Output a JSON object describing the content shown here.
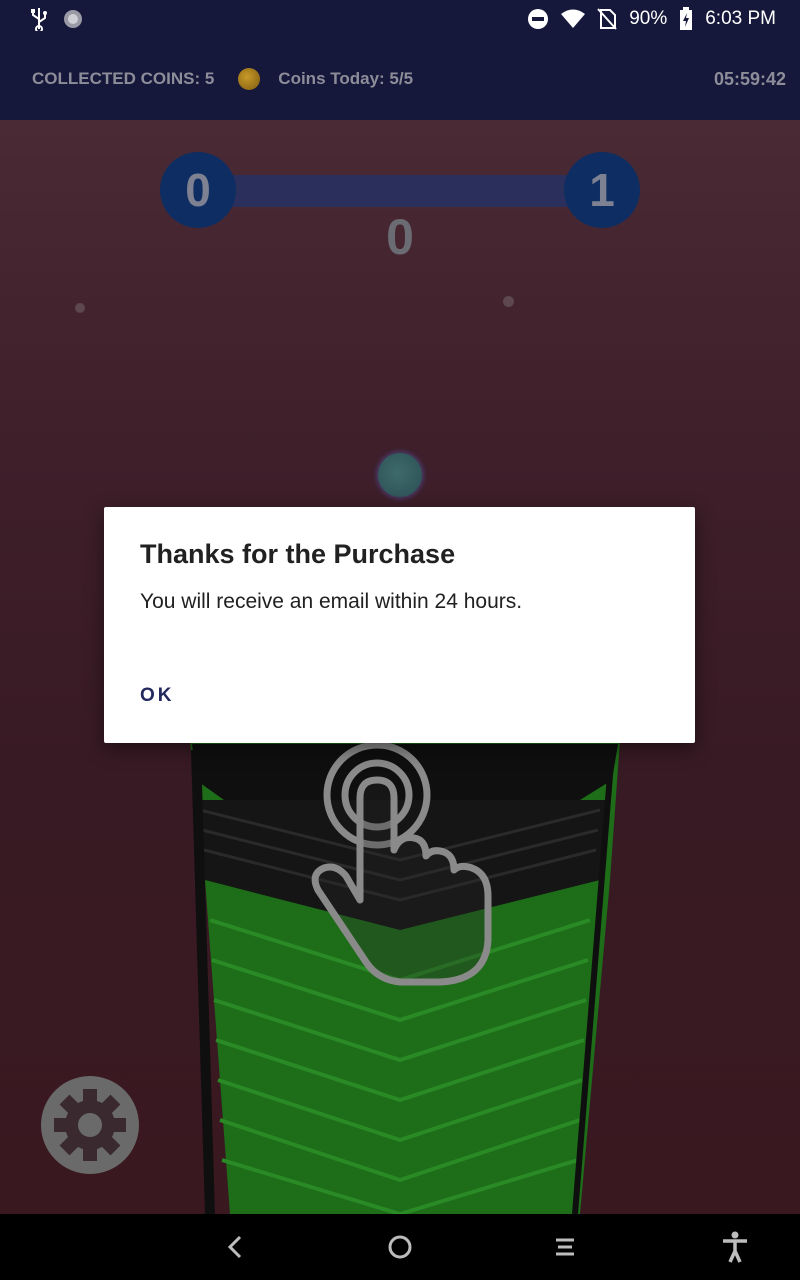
{
  "status_bar": {
    "battery": "90%",
    "time": "6:03 PM",
    "icons": [
      "usb-icon",
      "sync-icon",
      "do-not-disturb-icon",
      "wifi-icon",
      "no-sim-icon",
      "battery-charging-icon"
    ]
  },
  "header": {
    "collected_coins": "COLLECTED COINS: 5",
    "coins_today": "Coins Today:  5/5",
    "timer": "05:59:42"
  },
  "game": {
    "level_current": "0",
    "level_next": "1",
    "score": "0",
    "level_progress": 0
  },
  "dialog": {
    "title": "Thanks for the Purchase",
    "message": "You will receive an email within 24 hours.",
    "ok_label": "OK"
  },
  "nav_bar": {
    "icons": [
      "back-icon",
      "home-icon",
      "recents-icon",
      "accessibility-icon"
    ]
  },
  "colors": {
    "header_bg": "#15183a",
    "accent": "#23285e",
    "level_circle": "#0e2e63",
    "tower_green": "#1f7a1c"
  }
}
